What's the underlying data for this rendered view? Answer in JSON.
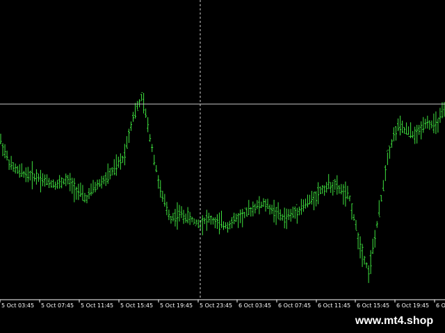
{
  "colors": {
    "background": "#000000",
    "candle": "#3fe33f",
    "axis": "#ffffff",
    "crosshair": "#c8c8c8",
    "label": "#ffffff"
  },
  "watermark": "www.mt4.shop",
  "chart_data": {
    "type": "line",
    "grid": false,
    "crosshair": {
      "vertical_at": "5 Oct 23:45"
    },
    "x_ticks": [
      "5 Oct 03:45",
      "5 Oct 07:45",
      "5 Oct 11:45",
      "5 Oct 15:45",
      "5 Oct 19:45",
      "5 Oct 23:45",
      "6 Oct 03:45",
      "6 Oct 07:45",
      "6 Oct 11:45",
      "6 Oct 15:45",
      "6 Oct 19:45",
      "6 Oct"
    ],
    "ylim": [
      0,
      100
    ],
    "series": [
      {
        "values": [
          62,
          52,
          49,
          48,
          47,
          45,
          44,
          46,
          42,
          38,
          43,
          46,
          50,
          55,
          72,
          80,
          60,
          40,
          30,
          32,
          30,
          28,
          30,
          28,
          27,
          30,
          32,
          35,
          36,
          33,
          30,
          32,
          35,
          38,
          42,
          44,
          42,
          38,
          20,
          8,
          30,
          56,
          68,
          66,
          64,
          70,
          68,
          74
        ]
      }
    ]
  }
}
